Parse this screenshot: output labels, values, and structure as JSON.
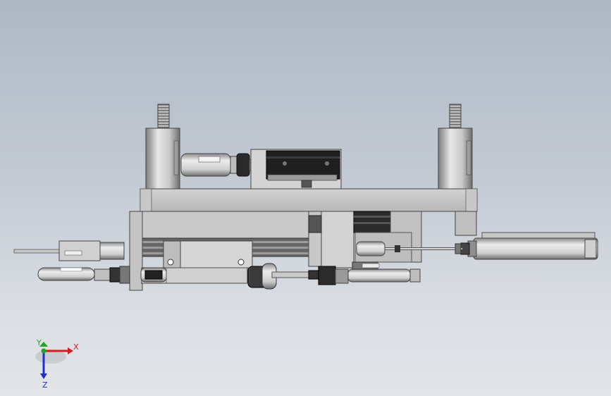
{
  "viewport": {
    "background_top": "#aeb8c5",
    "background_bottom": "#e3e5e8"
  },
  "triad": {
    "x_label": "X",
    "y_label": "Y",
    "z_label": "Z",
    "x_color": "#d11f1f",
    "y_color": "#1fa51f",
    "z_color": "#1f2fd1"
  },
  "model": {
    "icon": "cad-assembly-side-view",
    "metal_light": "#d9d9d9",
    "metal_mid": "#b4b4b4",
    "metal_dark": "#555555",
    "black_part": "#1e1e1e"
  }
}
